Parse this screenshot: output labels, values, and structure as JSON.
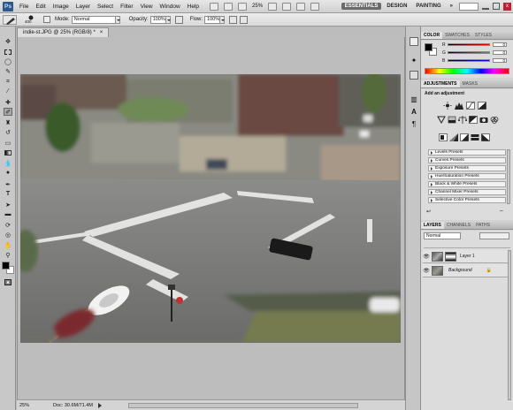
{
  "app": {
    "logo": "Ps"
  },
  "menubar": {
    "items": [
      "File",
      "Edit",
      "Image",
      "Layer",
      "Select",
      "Filter",
      "View",
      "Window",
      "Help"
    ],
    "zoom": "25%",
    "workspaces": [
      "ESSENTIALS",
      "DESIGN",
      "PAINTING"
    ],
    "more": "»"
  },
  "options": {
    "brush_size": "400",
    "mode_label": "Mode:",
    "mode_value": "Normal",
    "opacity_label": "Opacity:",
    "opacity_value": "100%",
    "flow_label": "Flow:",
    "flow_value": "100%"
  },
  "document": {
    "tab_title": "indie-st.JPG @ 25% (RGB/8) *",
    "close": "×"
  },
  "status": {
    "zoom": "25%",
    "doc": "Doc: 30.6M/71.4M"
  },
  "color_panel": {
    "tabs": [
      "COLOR",
      "SWATCHES",
      "STYLES"
    ],
    "channels": [
      {
        "letter": "R",
        "value": "0"
      },
      {
        "letter": "G",
        "value": "0"
      },
      {
        "letter": "B",
        "value": "0"
      }
    ]
  },
  "adjustments_panel": {
    "tabs": [
      "ADJUSTMENTS",
      "MASKS"
    ],
    "heading": "Add an adjustment",
    "presets": [
      "Levels Presets",
      "Curves Presets",
      "Exposure Presets",
      "Hue/Saturation Presets",
      "Black & White Presets",
      "Channel Mixer Presets",
      "Selective Color Presets"
    ]
  },
  "layers_panel": {
    "tabs": [
      "LAYERS",
      "CHANNELS",
      "PATHS"
    ],
    "blend_mode": "Normal",
    "layers": [
      {
        "name": "Layer 1"
      },
      {
        "name": "Background"
      }
    ]
  },
  "colors": {
    "workspace_active": "#6a6a6a",
    "foreground": "#000000",
    "background": "#ffffff"
  }
}
